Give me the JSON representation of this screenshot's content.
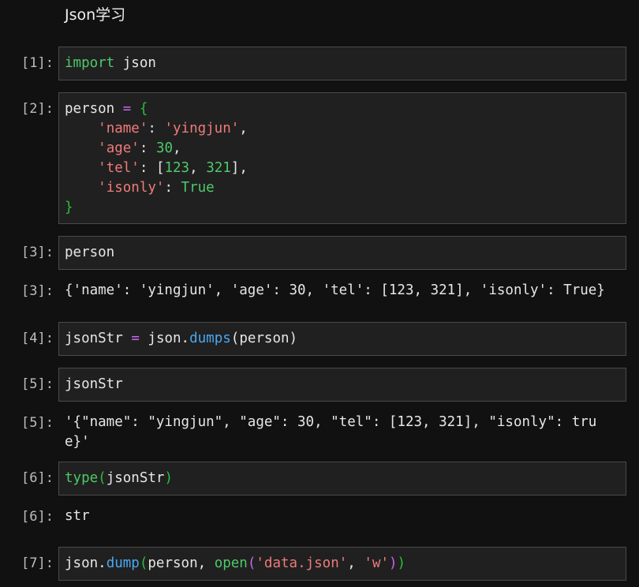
{
  "markdown": {
    "title": "Json学习"
  },
  "cells": [
    {
      "prompt": "[1]:",
      "code": {
        "kw": "import",
        "rest": " json"
      }
    },
    {
      "prompt": "[2]:",
      "code": {
        "line1": {
          "var": "person",
          "eq": "=",
          "brace": "{"
        },
        "line2": {
          "key": "'name'",
          "colon": ":",
          "val": "'yingjun'",
          "comma": ","
        },
        "line3": {
          "key": "'age'",
          "colon": ":",
          "val": "30",
          "comma": ","
        },
        "line4": {
          "key": "'tel'",
          "colon": ":",
          "open": "[",
          "v1": "123",
          "sep": ",",
          "v2": "321",
          "close": "],"
        },
        "line5": {
          "key": "'isonly'",
          "colon": ":",
          "val": "True"
        },
        "line6": {
          "brace": "}"
        }
      }
    },
    {
      "prompt": "[3]:",
      "code": {
        "text": "person"
      }
    },
    {
      "prompt": "[4]:",
      "code": {
        "var": "jsonStr",
        "eq": "=",
        "obj": "json.",
        "fn": "dumps",
        "args": "(person)"
      }
    },
    {
      "prompt": "[5]:",
      "code": {
        "text": "jsonStr"
      }
    },
    {
      "prompt": "[6]:",
      "code": {
        "fn": "type",
        "open": "(",
        "arg": "jsonStr",
        "close": ")"
      }
    },
    {
      "prompt": "[7]:",
      "code": {
        "obj": "json.",
        "fn": "dump",
        "open": "(",
        "arg1": "person, ",
        "fn2": "open",
        "open2": "(",
        "s1": "'data.json'",
        "sep": ", ",
        "s2": "'w'",
        "close2": ")",
        "close": ")"
      }
    }
  ],
  "outputs": [
    {
      "prompt": "[3]:",
      "text": "{'name': 'yingjun', 'age': 30, 'tel': [123, 321], 'isonly': True}"
    },
    {
      "prompt": "[5]:",
      "text": "'{\"name\": \"yingjun\", \"age\": 30, \"tel\": [123, 321], \"isonly\": true}'"
    },
    {
      "prompt": "[6]:",
      "text": "str"
    }
  ]
}
